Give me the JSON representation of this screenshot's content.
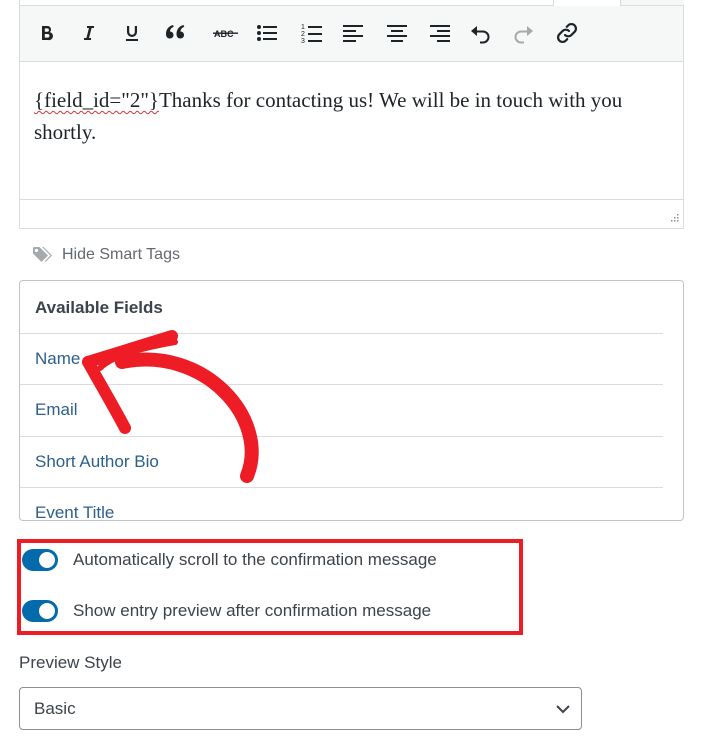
{
  "editor": {
    "toolbar": [
      "bold",
      "italic",
      "underline",
      "blockquote",
      "strikethrough",
      "bulleted-list",
      "numbered-list",
      "align-left",
      "align-center",
      "align-right",
      "undo",
      "redo",
      "link"
    ],
    "content_tag": "{field_id=\"2\"}",
    "content_text": "Thanks for contacting us! We will be in touch with you shortly."
  },
  "smart_tags": {
    "toggle_label": "Hide Smart Tags"
  },
  "available_fields": {
    "title": "Available Fields",
    "items": [
      "Name",
      "Email",
      "Short Author Bio",
      "Event Title"
    ]
  },
  "toggles": [
    {
      "label": "Automatically scroll to the confirmation message",
      "enabled": true
    },
    {
      "label": "Show entry preview after confirmation message",
      "enabled": true
    }
  ],
  "preview_style": {
    "label": "Preview Style",
    "selected": "Basic"
  },
  "colors": {
    "toggle_on": "#036aab",
    "annotation": "#ee1c25",
    "field_link": "#2c5f8a"
  }
}
